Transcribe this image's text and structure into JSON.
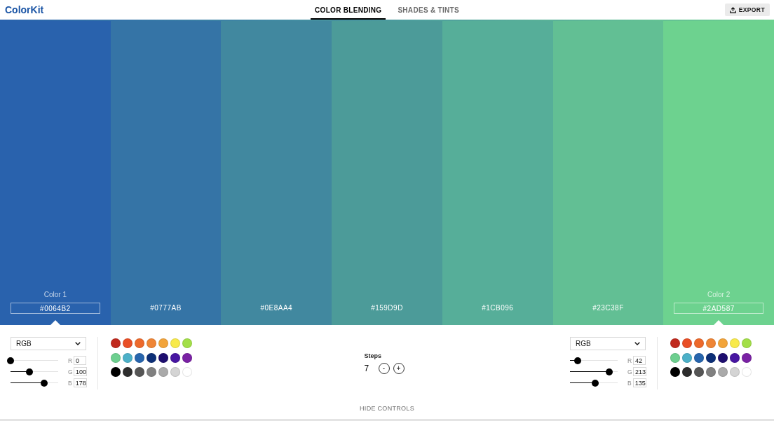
{
  "header": {
    "logo": "ColorKit",
    "tabs": [
      {
        "label": "COLOR BLENDING",
        "selected": true
      },
      {
        "label": "SHADES & TINTS",
        "selected": false
      }
    ],
    "export_button": "EXPORT"
  },
  "swatches": [
    {
      "kind": "endpoint",
      "label": "Color 1",
      "hex": "#0064B2",
      "color": "#2962ad"
    },
    {
      "kind": "step",
      "hex": "#0777AB",
      "color": "#3574a6"
    },
    {
      "kind": "step",
      "hex": "#0E8AA4",
      "color": "#41889f"
    },
    {
      "kind": "step",
      "hex": "#159D9D",
      "color": "#4c9b99"
    },
    {
      "kind": "step",
      "hex": "#1CB096",
      "color": "#56ae99"
    },
    {
      "kind": "step",
      "hex": "#23C38F",
      "color": "#62bf94"
    },
    {
      "kind": "endpoint",
      "label": "Color 2",
      "hex": "#2AD587",
      "color": "#6dd28f"
    }
  ],
  "controls": {
    "panels": [
      {
        "kind": "picker",
        "mode": "RGB",
        "channels": [
          {
            "name": "R",
            "value": "0",
            "level": 0
          },
          {
            "name": "G",
            "value": "100",
            "level": 0.39
          },
          {
            "name": "B",
            "value": "178",
            "level": 0.7
          }
        ],
        "palette": [
          {
            "color": "#c0291d"
          },
          {
            "color": "#e94f26"
          },
          {
            "color": "#ed692b"
          },
          {
            "color": "#ef8535"
          },
          {
            "color": "#f2a43b"
          },
          {
            "color": "#f8ea4b"
          },
          {
            "color": "#a3df48"
          },
          {
            "color": "#6dcf8f"
          },
          {
            "color": "#4cb0c8"
          },
          {
            "color": "#2765ad"
          },
          {
            "color": "#0d2f77"
          },
          {
            "color": "#1e0e6f"
          },
          {
            "color": "#4816a2"
          },
          {
            "color": "#7a22a4"
          },
          {
            "color": "#000000"
          },
          {
            "color": "#2d2d2d"
          },
          {
            "color": "#555555"
          },
          {
            "color": "#808080"
          },
          {
            "color": "#aaaaaa"
          },
          {
            "color": "#d4d4d4"
          },
          {
            "color": "#ffffff"
          }
        ]
      },
      {
        "kind": "steps",
        "label": "Steps",
        "value": "7",
        "decrement": "-",
        "increment": "+"
      },
      {
        "kind": "picker",
        "mode": "RGB",
        "channels": [
          {
            "name": "R",
            "value": "42",
            "level": 0.16
          },
          {
            "name": "G",
            "value": "213",
            "level": 0.83
          },
          {
            "name": "B",
            "value": "135",
            "level": 0.53
          }
        ],
        "palette": [
          {
            "color": "#c0291d"
          },
          {
            "color": "#e94f26"
          },
          {
            "color": "#ed692b"
          },
          {
            "color": "#ef8535"
          },
          {
            "color": "#f2a43b"
          },
          {
            "color": "#f8ea4b"
          },
          {
            "color": "#a3df48"
          },
          {
            "color": "#6dcf8f"
          },
          {
            "color": "#4cb0c8"
          },
          {
            "color": "#2765ad"
          },
          {
            "color": "#0d2f77"
          },
          {
            "color": "#1e0e6f"
          },
          {
            "color": "#4816a2"
          },
          {
            "color": "#7a22a4"
          },
          {
            "color": "#000000"
          },
          {
            "color": "#2d2d2d"
          },
          {
            "color": "#555555"
          },
          {
            "color": "#808080"
          },
          {
            "color": "#aaaaaa"
          },
          {
            "color": "#d4d4d4"
          },
          {
            "color": "#ffffff"
          }
        ]
      }
    ],
    "toggle_button": "HIDE CONTROLS"
  }
}
